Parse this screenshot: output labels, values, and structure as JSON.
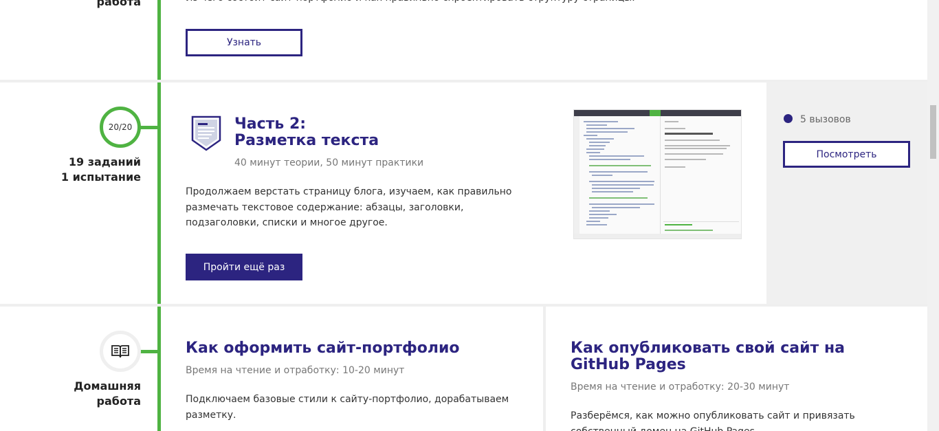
{
  "top_section": {
    "left_label": "работа",
    "cut_text": "Из чего состоит сайт-портфолио и как правильно спроектировать структуру страницы.",
    "button_label": "Узнать"
  },
  "part2": {
    "progress": "20/20",
    "tasks": "19 заданий",
    "trials": "1 испытание",
    "title_line1": "Часть 2:",
    "title_line2": "Разметка текста",
    "meta": "40 минут теории, 50 минут практики",
    "description": "Продолжаем верстать страницу блога, изучаем, как правильно размечать текстовое содержание: абзацы, заголовки, подзаголовки, списки и многое другое.",
    "button_label": "Пройти ещё раз",
    "challenges_label": "5 вызовов",
    "view_button_label": "Посмотреть"
  },
  "homework": {
    "label_line1": "Домашняя",
    "label_line2": "работа",
    "card1": {
      "title": "Как оформить сайт-портфолио",
      "meta": "Время на чтение и отработку: 10-20 минут",
      "description": "Подключаем базовые стили к сайту-портфолио, дорабатываем разметку."
    },
    "card2": {
      "title": "Как опубликовать свой сайт на GitHub Pages",
      "meta": "Время на чтение и отработку: 20-30 минут",
      "description": "Разберёмся, как можно опубликовать сайт и привязать собственный домен на GitHub Pages."
    }
  },
  "colors": {
    "accent": "#2c2480",
    "progress_green": "#4fb342",
    "panel_gray": "#f0f0f0"
  },
  "icons": {
    "part_icon": "shield-document-icon",
    "homework_icon": "open-book-icon",
    "challenge_bullet": "dot-icon"
  }
}
